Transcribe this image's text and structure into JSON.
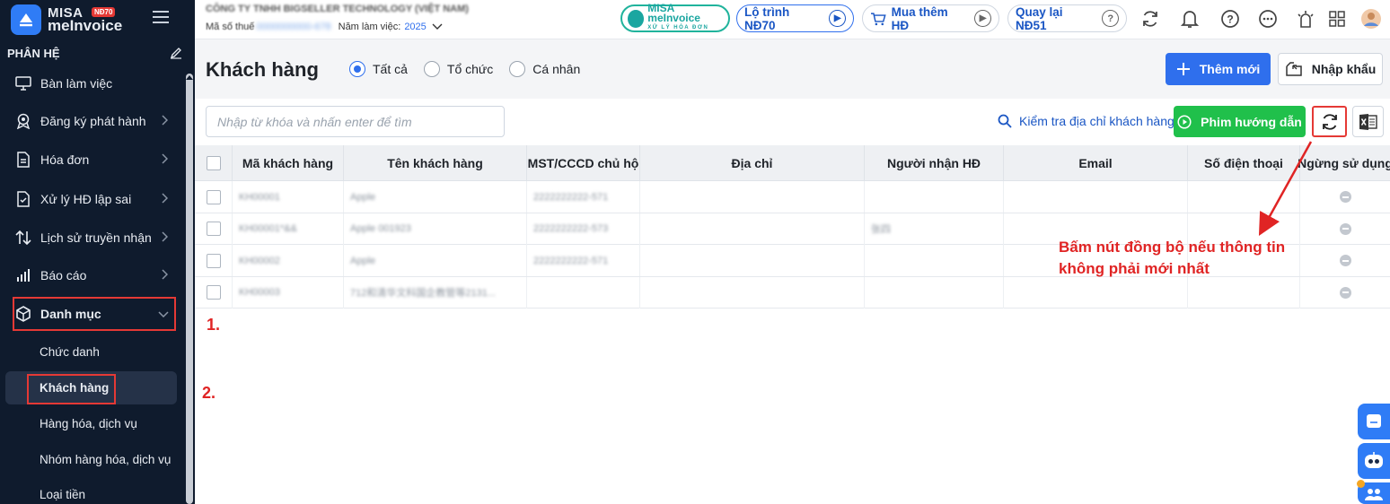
{
  "app": {
    "logo_line1": "MISA",
    "logo_line2": "meInvoice",
    "logo_badge": "NĐ70"
  },
  "sidebar": {
    "section_title": "PHÂN HỆ",
    "items": [
      {
        "label": "Bàn làm việc"
      },
      {
        "label": "Đăng ký phát hành"
      },
      {
        "label": "Hóa đơn"
      },
      {
        "label": "Xử lý HĐ lập sai"
      },
      {
        "label": "Lịch sử truyền nhận"
      },
      {
        "label": "Báo cáo"
      },
      {
        "label": "Danh mục"
      }
    ],
    "sub_items": [
      {
        "label": "Chức danh"
      },
      {
        "label": "Khách hàng"
      },
      {
        "label": "Hàng hóa, dịch vụ"
      },
      {
        "label": "Nhóm hàng hóa, dịch vụ"
      },
      {
        "label": "Loại tiền"
      }
    ]
  },
  "header": {
    "company_name": "CÔNG TY TNHH BIGSELLER TECHNOLOGY (VIỆT NAM)",
    "tax_label": "Mã số thuế",
    "tax_value": "0000000000-678",
    "year_label": "Năm làm việc:",
    "year_value": "2025",
    "brand_name": "MISA meInvoice",
    "brand_tagline": "XỬ LÝ HÓA ĐƠN",
    "roadmap_label": "Lộ trình NĐ70",
    "buy_more_label": "Mua thêm HĐ",
    "back_label": "Quay lại NĐ51"
  },
  "page": {
    "title": "Khách hàng",
    "filters": [
      {
        "label": "Tất cả",
        "selected": true
      },
      {
        "label": "Tổ chức",
        "selected": false
      },
      {
        "label": "Cá nhân",
        "selected": false
      }
    ],
    "add_new_label": "Thêm mới",
    "import_label": "Nhập khẩu",
    "search_placeholder": "Nhập từ khóa và nhấn enter để tìm",
    "check_address_label": "Kiểm tra địa chỉ khách hàng",
    "guide_video_label": "Phim hướng dẫn"
  },
  "table": {
    "columns": [
      "Mã khách hàng",
      "Tên khách hàng",
      "MST/CCCD chủ hộ",
      "Địa chỉ",
      "Người nhận HĐ",
      "Email",
      "Số điện thoại",
      "Ngừng sử dụng"
    ],
    "rows": [
      {
        "code": "KH00001",
        "name": "Apple",
        "tax": "2222222222-571",
        "address": "",
        "receiver": "",
        "email": "",
        "phone": ""
      },
      {
        "code": "KH00001*&&",
        "name": "Apple 001923",
        "tax": "2222222222-573",
        "address": "",
        "receiver": "张四",
        "email": "",
        "phone": ""
      },
      {
        "code": "KH00002",
        "name": "Apple",
        "tax": "2222222222-571",
        "address": "",
        "receiver": "",
        "email": "",
        "phone": ""
      },
      {
        "code": "KH00003",
        "name": "712和清华文科国企教管等2131...",
        "tax": "",
        "address": "",
        "receiver": "",
        "email": "",
        "phone": ""
      }
    ]
  },
  "annotations": {
    "step1": "1.",
    "step2": "2.",
    "hint_line1": "Bấm nút đồng bộ nếu thông tin",
    "hint_line2": "không phải mới nhất"
  },
  "colors": {
    "sidebar_bg": "#0f1b2d",
    "primary": "#2f6fed",
    "green": "#20c04b",
    "annotation_red": "#e02424"
  }
}
